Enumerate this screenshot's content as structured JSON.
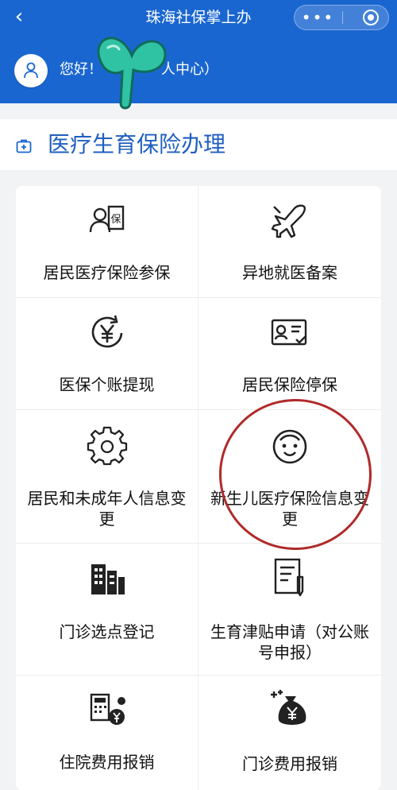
{
  "header": {
    "back_icon": "chevron-left-icon",
    "title": "珠海社保掌上办",
    "more_label": "•••",
    "brand_color": "#1a66d1"
  },
  "user": {
    "greeting": "您好！",
    "greeting_tail": "人中心）"
  },
  "section": {
    "title": "医疗生育保险办理"
  },
  "services": [
    {
      "label": "居民医疗保险参保",
      "icon": "insurance-user-icon"
    },
    {
      "label": "异地就医备案",
      "icon": "airplane-icon"
    },
    {
      "label": "医保个账提现",
      "icon": "yen-refresh-icon"
    },
    {
      "label": "居民保险停保",
      "icon": "id-card-check-icon"
    },
    {
      "label": "居民和未成年人信息变更",
      "icon": "gear-icon"
    },
    {
      "label": "新生儿医疗保险信息变更",
      "icon": "baby-face-icon"
    },
    {
      "label": "门诊选点登记",
      "icon": "buildings-icon"
    },
    {
      "label": "生育津贴申请（对公账号申报）",
      "icon": "document-pen-icon"
    },
    {
      "label": "住院费用报销",
      "icon": "calculator-yen-icon"
    },
    {
      "label": "门诊费用报销",
      "icon": "money-bag-icon"
    }
  ],
  "annotation": {
    "circle_color": "#b02a2a"
  }
}
